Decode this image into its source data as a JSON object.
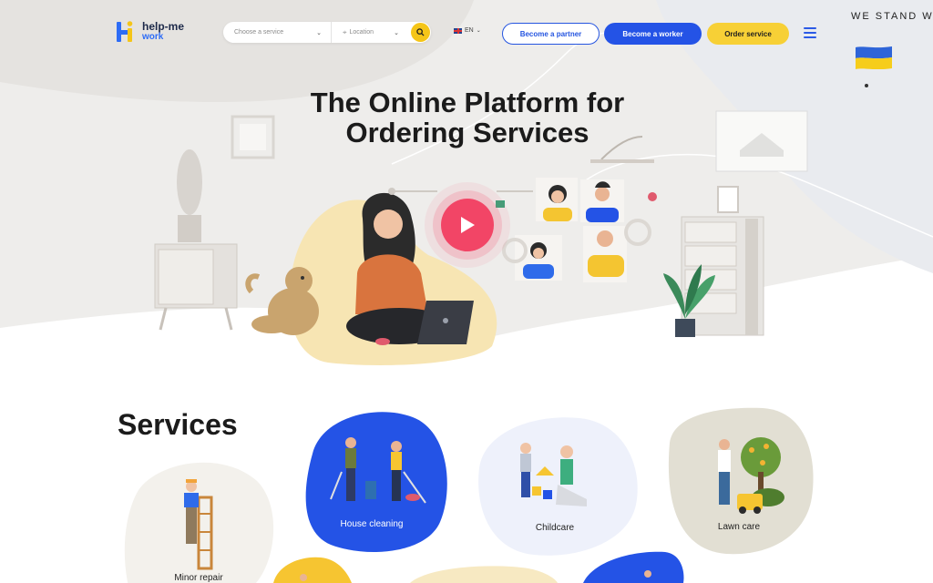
{
  "header": {
    "logo_line1": "help-me",
    "logo_line2": "work",
    "service_placeholder": "Choose a service",
    "location_placeholder": "Location",
    "language": "EN",
    "partner_label": "Become a partner",
    "worker_label": "Become a worker",
    "order_label": "Order service",
    "stand_text": "WE STAND W"
  },
  "hero": {
    "title_line1": "The Online Platform for",
    "title_line2": "Ordering Services"
  },
  "services": {
    "title": "Services",
    "items": [
      {
        "label": "Minor repair"
      },
      {
        "label": "House cleaning"
      },
      {
        "label": "Childcare"
      },
      {
        "label": "Lawn care"
      }
    ]
  },
  "colors": {
    "primary_blue": "#2453e6",
    "accent_yellow": "#f7d036",
    "play_red": "#f24566",
    "hero_bg": "#efeeec"
  },
  "icons": [
    "search-icon",
    "chevron-down-icon",
    "location-pin-icon",
    "uk-flag-icon",
    "menu-icon",
    "ukraine-flag-icon",
    "play-icon"
  ]
}
